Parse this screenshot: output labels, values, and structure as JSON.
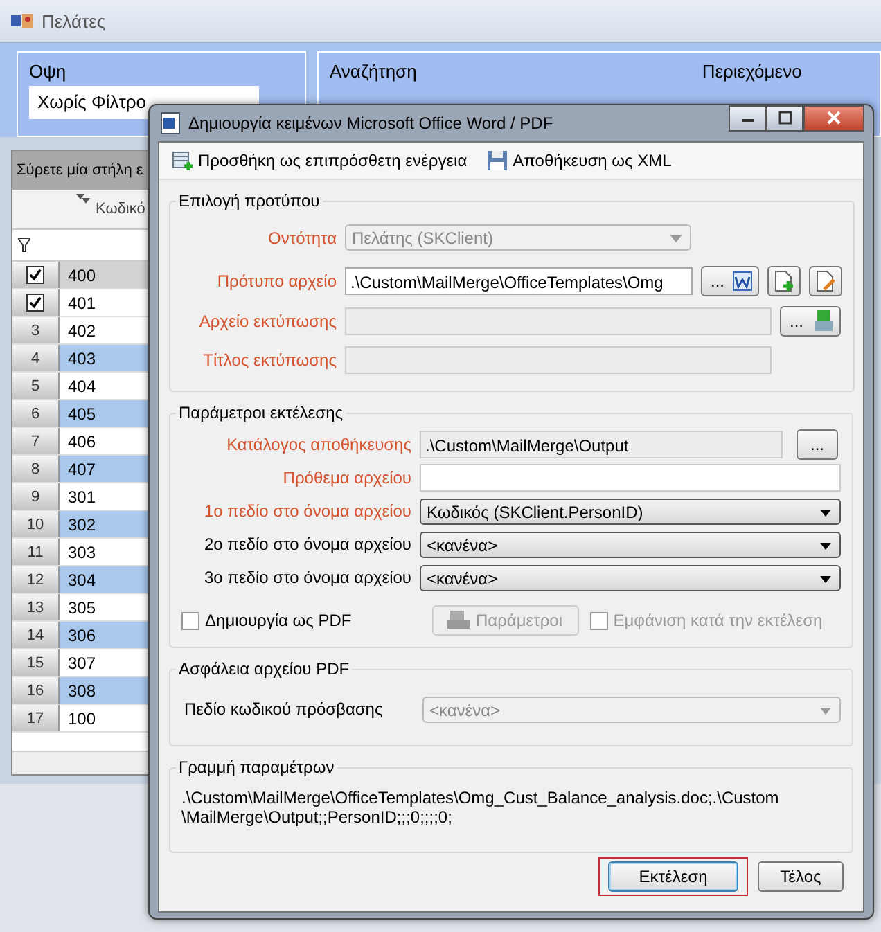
{
  "app": {
    "title": "Πελάτες"
  },
  "view": {
    "label": "Οψη",
    "value": "Χωρίς Φίλτρο"
  },
  "search": {
    "label": "Αναζήτηση"
  },
  "content": {
    "label": "Περιεχόμενο"
  },
  "grid": {
    "group_hint": "Σύρετε μία στήλη ε",
    "column": "Κωδικό",
    "rows": [
      {
        "checked": true,
        "code": "400",
        "kind": "current"
      },
      {
        "checked": true,
        "code": "401",
        "kind": "plain"
      },
      {
        "checked": false,
        "number": "3",
        "code": "402",
        "kind": "plain"
      },
      {
        "checked": false,
        "number": "4",
        "code": "403",
        "kind": "alt"
      },
      {
        "checked": false,
        "number": "5",
        "code": "404",
        "kind": "plain"
      },
      {
        "checked": false,
        "number": "6",
        "code": "405",
        "kind": "alt"
      },
      {
        "checked": false,
        "number": "7",
        "code": "406",
        "kind": "plain"
      },
      {
        "checked": false,
        "number": "8",
        "code": "407",
        "kind": "alt"
      },
      {
        "checked": false,
        "number": "9",
        "code": "301",
        "kind": "plain"
      },
      {
        "checked": false,
        "number": "10",
        "code": "302",
        "kind": "alt"
      },
      {
        "checked": false,
        "number": "11",
        "code": "303",
        "kind": "plain"
      },
      {
        "checked": false,
        "number": "12",
        "code": "304",
        "kind": "alt"
      },
      {
        "checked": false,
        "number": "13",
        "code": "305",
        "kind": "plain"
      },
      {
        "checked": false,
        "number": "14",
        "code": "306",
        "kind": "alt"
      },
      {
        "checked": false,
        "number": "15",
        "code": "307",
        "kind": "plain"
      },
      {
        "checked": false,
        "number": "16",
        "code": "308",
        "kind": "alt"
      },
      {
        "checked": false,
        "number": "17",
        "code": "100",
        "kind": "plain"
      }
    ]
  },
  "dialog": {
    "title": "Δημιουργία κειμένων Microsoft Office Word / PDF",
    "toolbar": [
      {
        "label": "Προσθήκη ως επιπρόσθετη ενέργεια",
        "kind": "add"
      },
      {
        "label": "Αποθήκευση ως XML",
        "kind": "save"
      }
    ],
    "template_group": {
      "title": "Επιλογή προτύπου",
      "fields": [
        {
          "label": "Οντότητα",
          "kind": "combo",
          "value": "Πελάτης (SKClient)",
          "required": true,
          "disabled": true
        },
        {
          "label": "Πρότυπο αρχείο",
          "kind": "file",
          "value": ".\\Custom\\MailMerge\\OfficeTemplates\\Omg",
          "button": "...",
          "required": true,
          "disabled": false
        },
        {
          "label": "Αρχείο εκτύπωσης",
          "kind": "print",
          "button": "...",
          "required": true,
          "disabled": true
        },
        {
          "label": "Τίτλος εκτύπωσης",
          "kind": "text",
          "required": true,
          "disabled": true
        }
      ]
    },
    "exec_group": {
      "title": "Παράμετροι εκτέλεσης",
      "fields": [
        {
          "label": "Κατάλογος αποθήκευσης",
          "kind": "folder",
          "value": ".\\Custom\\MailMerge\\Output",
          "button": "...",
          "required": true,
          "disabled": true
        },
        {
          "label": "Πρόθεμα αρχείου",
          "kind": "text",
          "required": true,
          "disabled": false
        },
        {
          "label": "1ο πεδίο στο όνομα αρχείου",
          "kind": "combo",
          "value": "Κωδικός (SKClient.PersonID)",
          "required": true,
          "disabled": false
        },
        {
          "label": "2ο πεδίο στο όνομα αρχείου",
          "kind": "combo",
          "value": "<κανένα>",
          "required": false,
          "disabled": false
        },
        {
          "label": "3ο πεδίο στο όνομα αρχείου",
          "kind": "combo",
          "value": "<κανένα>",
          "required": false,
          "disabled": false
        }
      ],
      "pdf_checkbox": {
        "label": "Δημιουργία ως PDF",
        "checked": false,
        "disabled": false
      },
      "params_button": {
        "label": "Παράμετροι",
        "disabled": true
      },
      "show_checkbox": {
        "label": "Εμφάνιση κατά την εκτέλεση",
        "checked": false,
        "disabled": true
      }
    },
    "security_group": {
      "title": "Ασφάλεια αρχείου PDF",
      "fields": [
        {
          "label": "Πεδίο κωδικού πρόσβασης",
          "kind": "combo",
          "value": "<κανένα>",
          "required": false,
          "disabled": true
        }
      ]
    },
    "params_line": {
      "title": "Γραμμή παραμέτρων",
      "lines": [
        ".\\Custom\\MailMerge\\OfficeTemplates\\Omg_Cust_Balance_analysis.doc;.\\Custom",
        "\\MailMerge\\Output;;PersonID;;;0;;;;0;"
      ]
    },
    "buttons": [
      {
        "label": "Εκτέλεση",
        "default": true
      },
      {
        "label": "Τέλος",
        "default": false
      }
    ]
  }
}
